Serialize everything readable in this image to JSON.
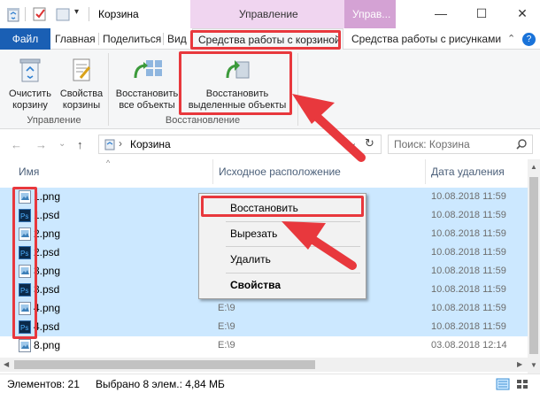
{
  "window": {
    "title": "Корзина",
    "contextual_tab_a": "Управление",
    "contextual_tab_b": "Управ...",
    "minimize": "—",
    "maximize": "☐",
    "close": "✕"
  },
  "ribbon_tabs": {
    "file": "Файл",
    "home": "Главная",
    "share": "Поделиться",
    "view": "Вид",
    "bin_tools": "Средства работы с корзиной",
    "picture_tools": "Средства работы с рисунками",
    "collapse": "⌃",
    "help": "?"
  },
  "ribbon": {
    "empty_bin": "Очистить корзину",
    "bin_props": "Свойства корзины",
    "restore_all": "Восстановить все объекты",
    "restore_selected": "Восстановить выделенные объекты",
    "group_manage": "Управление",
    "group_restore": "Восстановление"
  },
  "navigation": {
    "back": "←",
    "forward": "→",
    "recent": "⌄",
    "up": "↑",
    "address_chevron": "›",
    "address": "Корзина",
    "dropdown": "⌄",
    "refresh": "↻",
    "search_placeholder": "Поиск: Корзина"
  },
  "columns": {
    "name": "Имя",
    "original_location": "Исходное расположение",
    "date_deleted": "Дата удаления"
  },
  "files": [
    {
      "name": "1.png",
      "type": "png",
      "orig": "",
      "date": "10.08.2018 11:59",
      "selected": true
    },
    {
      "name": "1.psd",
      "type": "psd",
      "orig": "",
      "date": "10.08.2018 11:59",
      "selected": true
    },
    {
      "name": "2.png",
      "type": "png",
      "orig": "",
      "date": "10.08.2018 11:59",
      "selected": true
    },
    {
      "name": "2.psd",
      "type": "psd",
      "orig": "",
      "date": "10.08.2018 11:59",
      "selected": true
    },
    {
      "name": "3.png",
      "type": "png",
      "orig": "",
      "date": "10.08.2018 11:59",
      "selected": true
    },
    {
      "name": "3.psd",
      "type": "psd",
      "orig": "",
      "date": "10.08.2018 11:59",
      "selected": true
    },
    {
      "name": "4.png",
      "type": "png",
      "orig": "E:\\9",
      "date": "10.08.2018 11:59",
      "selected": true
    },
    {
      "name": "4.psd",
      "type": "psd",
      "orig": "E:\\9",
      "date": "10.08.2018 11:59",
      "selected": true
    },
    {
      "name": "8.png",
      "type": "png",
      "orig": "E:\\9",
      "date": "03.08.2018 12:14",
      "selected": false
    }
  ],
  "context_menu": {
    "restore": "Восстановить",
    "cut": "Вырезать",
    "delete": "Удалить",
    "properties": "Свойства"
  },
  "status": {
    "items": "Элементов: 21",
    "selected": "Выбрано 8 элем.: 4,84 МБ"
  },
  "colors": {
    "file_tab": "#1a5fb4",
    "contextual_light": "#f0d5f0",
    "contextual_dark": "#d4a2d4",
    "selection": "#cce8ff",
    "annotation": "#e8383d"
  }
}
